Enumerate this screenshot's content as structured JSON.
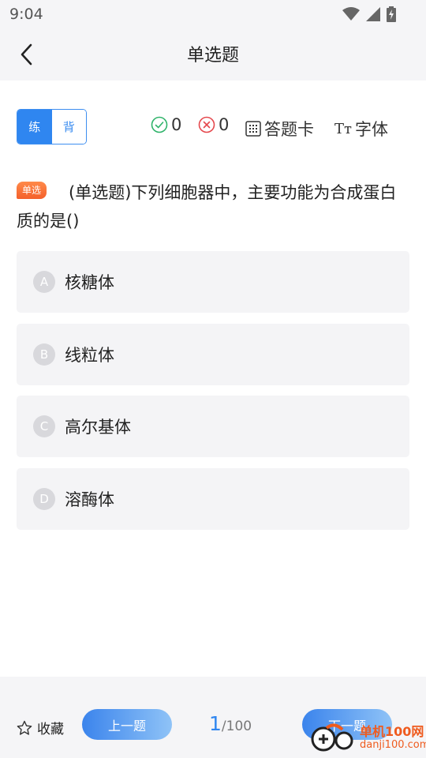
{
  "status_bar": {
    "time": "9:04"
  },
  "nav": {
    "title": "单选题"
  },
  "mode": {
    "practice": "练",
    "recite": "背"
  },
  "toolbar": {
    "correct_count": "0",
    "wrong_count": "0",
    "answer_card": "答题卡",
    "font_icon_text": "Tт",
    "font_label": "字体"
  },
  "question": {
    "badge": "单选",
    "text": "(单选题)下列细胞器中，主要功能为合成蛋白质的是()"
  },
  "options": [
    {
      "letter": "A",
      "text": "核糖体"
    },
    {
      "letter": "B",
      "text": "线粒体"
    },
    {
      "letter": "C",
      "text": "高尔基体"
    },
    {
      "letter": "D",
      "text": "溶酶体"
    }
  ],
  "footer": {
    "favorite": "收藏",
    "prev": "上一题",
    "next": "下一题",
    "current_page": "1",
    "total_pages": "/100"
  },
  "watermark": {
    "line1": "单机100网",
    "line2": "danji100.com"
  },
  "colors": {
    "accent": "#2f86f0",
    "badge": "#f4602b",
    "correct": "#2fb36a",
    "wrong": "#e5484d"
  }
}
